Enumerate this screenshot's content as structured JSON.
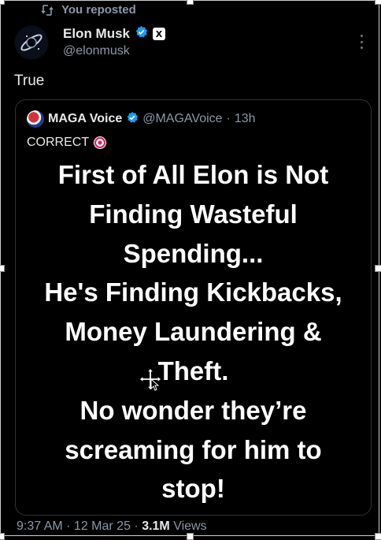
{
  "repost": {
    "label": "You reposted"
  },
  "post": {
    "author_name": "Elon Musk",
    "author_handle": "@elonmusk",
    "x_badge": "X",
    "text": "True",
    "timestamp": "9:37 AM · 12 Mar 25 · ",
    "views_count": "3.1M",
    "views_label": " Views"
  },
  "quote": {
    "author_name": "MAGA Voice",
    "author_handle": "@MAGAVoice",
    "time_sep": "·",
    "time": "13h",
    "text": "CORRECT",
    "image_lines": [
      "First of All Elon is Not",
      "Finding Wasteful",
      "Spending...",
      "He's Finding Kickbacks,",
      "Money Laundering &",
      "Theft.",
      "No wonder they’re",
      "screaming  for him to",
      "stop!"
    ]
  },
  "colors": {
    "background": "#000000",
    "verified": "#1d9bf0",
    "secondary_text": "#8b98a5",
    "primary_text": "#e7e9ea"
  },
  "icons": [
    "repost-icon",
    "verified-badge-icon",
    "x-logo-icon",
    "more-icon",
    "target-emoji-icon",
    "move-cursor-icon"
  ]
}
